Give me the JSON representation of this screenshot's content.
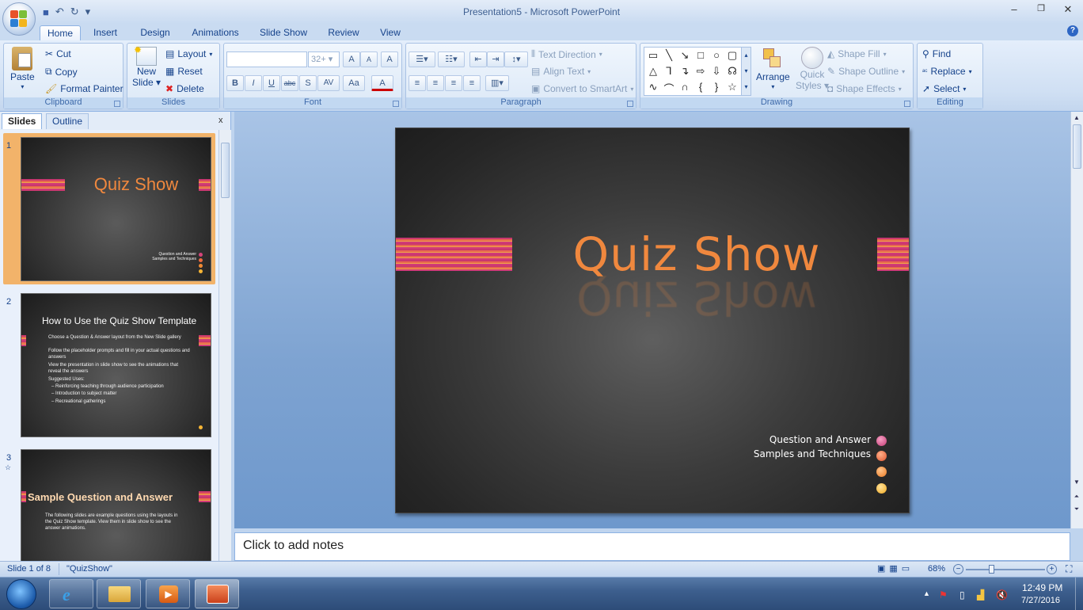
{
  "window": {
    "title": "Presentation5 - Microsoft PowerPoint",
    "minimize": "‒",
    "restore": "❐",
    "close": "✕"
  },
  "qat": {
    "save": "💾",
    "undo": "↶",
    "redo": "↻",
    "customize": "▾"
  },
  "tabs": [
    "Home",
    "Insert",
    "Design",
    "Animations",
    "Slide Show",
    "Review",
    "View"
  ],
  "active_tab": "Home",
  "ribbon": {
    "clipboard": {
      "label": "Clipboard",
      "paste": "Paste",
      "cut": "Cut",
      "copy": "Copy",
      "format_painter": "Format Painter"
    },
    "slides": {
      "label": "Slides",
      "new_slide_1": "New",
      "new_slide_2": "Slide",
      "layout": "Layout",
      "reset": "Reset",
      "delete": "Delete"
    },
    "font": {
      "label": "Font",
      "font_name": "",
      "font_size": "32+",
      "bold": "B",
      "italic": "I",
      "underline": "U",
      "strike": "abc",
      "shadow": "S",
      "spacing": "AV",
      "case": "Aa",
      "color": "A",
      "grow": "A",
      "shrink": "A",
      "clear": "A"
    },
    "paragraph": {
      "label": "Paragraph",
      "text_direction": "Text Direction",
      "align_text": "Align Text",
      "convert_smartart": "Convert to SmartArt"
    },
    "drawing": {
      "label": "Drawing",
      "arrange": "Arrange",
      "quick_styles_1": "Quick",
      "quick_styles_2": "Styles",
      "shape_fill": "Shape Fill",
      "shape_outline": "Shape Outline",
      "shape_effects": "Shape Effects"
    },
    "editing": {
      "label": "Editing",
      "find": "Find",
      "replace": "Replace",
      "select": "Select"
    }
  },
  "pane": {
    "tab_slides": "Slides",
    "tab_outline": "Outline",
    "close": "x"
  },
  "thumbnails": [
    {
      "num": "1",
      "title": "Quiz Show",
      "lines": [
        "Question and Answer",
        "Samples and Techniques"
      ]
    },
    {
      "num": "2",
      "title": "How to Use the Quiz Show Template",
      "bullets": [
        "Choose a Question & Answer layout from the New Slide gallery",
        "Follow the placeholder prompts and fill in your actual questions and answers",
        "View the presentation in slide show to see the animations that reveal the answers",
        "Suggested Uses:",
        "– Reinforcing teaching through audience participation",
        "– Introduction to subject matter",
        "– Recreational gatherings"
      ]
    },
    {
      "num": "3",
      "title": "Sample Question and Answer",
      "bullets": [
        "The following slides are example questions using the layouts in the Quiz Show template. View them in slide show to see the answer animations."
      ]
    }
  ],
  "slide": {
    "title": "Quiz Show",
    "subtitle_1": "Question and Answer",
    "subtitle_2": "Samples and Techniques"
  },
  "notes_placeholder": "Click to add notes",
  "status": {
    "slide_of": "Slide 1 of 8",
    "theme": "\"QuizShow\"",
    "zoom": "68%"
  },
  "taskbar": {
    "time": "12:49 PM",
    "date": "7/27/2016"
  },
  "colors": {
    "accent_orange": "#f0883e",
    "ribbon_blue": "#15428b",
    "selection": "#f5a64a"
  }
}
